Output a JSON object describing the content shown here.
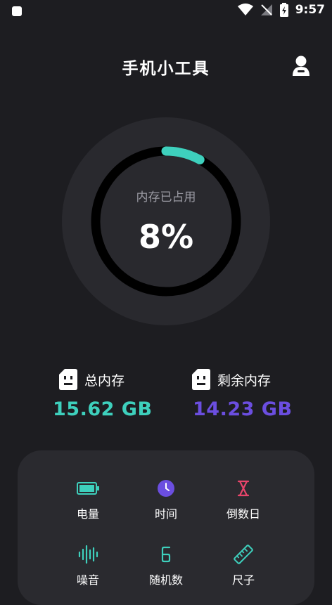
{
  "status_bar": {
    "time": "9:57"
  },
  "header": {
    "title": "手机小工具"
  },
  "memory": {
    "label": "内存已占用",
    "percent_text": "8%",
    "used_fraction": 0.08,
    "ring_color": "#3ed0bd"
  },
  "stats": {
    "total": {
      "label": "总内存",
      "value": "15.62 GB",
      "color": "#3ed0bd"
    },
    "free": {
      "label": "剩余内存",
      "value": "14.23 GB",
      "color": "#6b4ee0"
    }
  },
  "tools": [
    {
      "label": "电量",
      "icon": "battery-icon",
      "color": "#3ed0bd"
    },
    {
      "label": "时间",
      "icon": "clock-icon",
      "color": "#6b4ee0"
    },
    {
      "label": "倒数日",
      "icon": "hourglass-icon",
      "color": "#e8456b"
    },
    {
      "label": "噪音",
      "icon": "sound-wave-icon",
      "color": "#3ed0bd"
    },
    {
      "label": "随机数",
      "icon": "dice-number-icon",
      "color": "#3ed0bd"
    },
    {
      "label": "尺子",
      "icon": "ruler-icon",
      "color": "#3ed0bd"
    }
  ]
}
